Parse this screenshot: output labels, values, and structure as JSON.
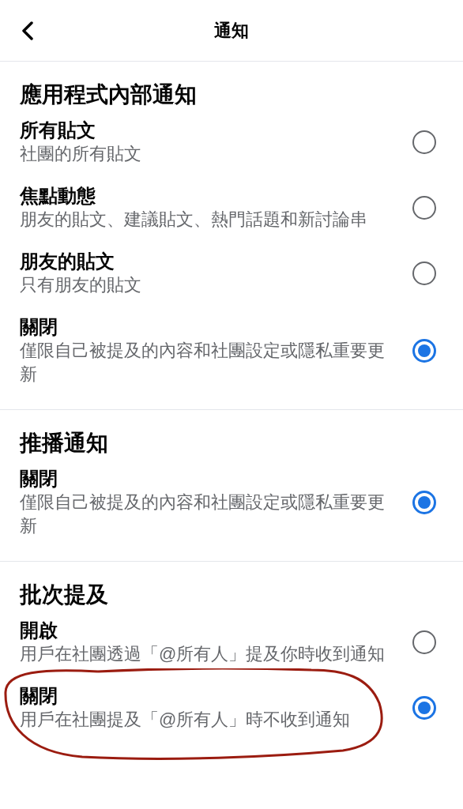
{
  "header": {
    "title": "通知"
  },
  "sections": [
    {
      "heading": "應用程式內部通知",
      "options": [
        {
          "title": "所有貼文",
          "subtitle": "社團的所有貼文",
          "selected": false
        },
        {
          "title": "焦點動態",
          "subtitle": "朋友的貼文、建議貼文、熱門話題和新討論串",
          "selected": false
        },
        {
          "title": "朋友的貼文",
          "subtitle": "只有朋友的貼文",
          "selected": false
        },
        {
          "title": "關閉",
          "subtitle": "僅限自己被提及的內容和社團設定或隱私重要更新",
          "selected": true
        }
      ]
    },
    {
      "heading": "推播通知",
      "options": [
        {
          "title": "關閉",
          "subtitle": "僅限自己被提及的內容和社團設定或隱私重要更新",
          "selected": true
        }
      ]
    },
    {
      "heading": "批次提及",
      "options": [
        {
          "title": "開啟",
          "subtitle": "用戶在社團透過「@所有人」提及你時收到通知",
          "selected": false
        },
        {
          "title": "關閉",
          "subtitle": "用戶在社團提及「@所有人」時不收到通知",
          "selected": true
        }
      ]
    }
  ]
}
